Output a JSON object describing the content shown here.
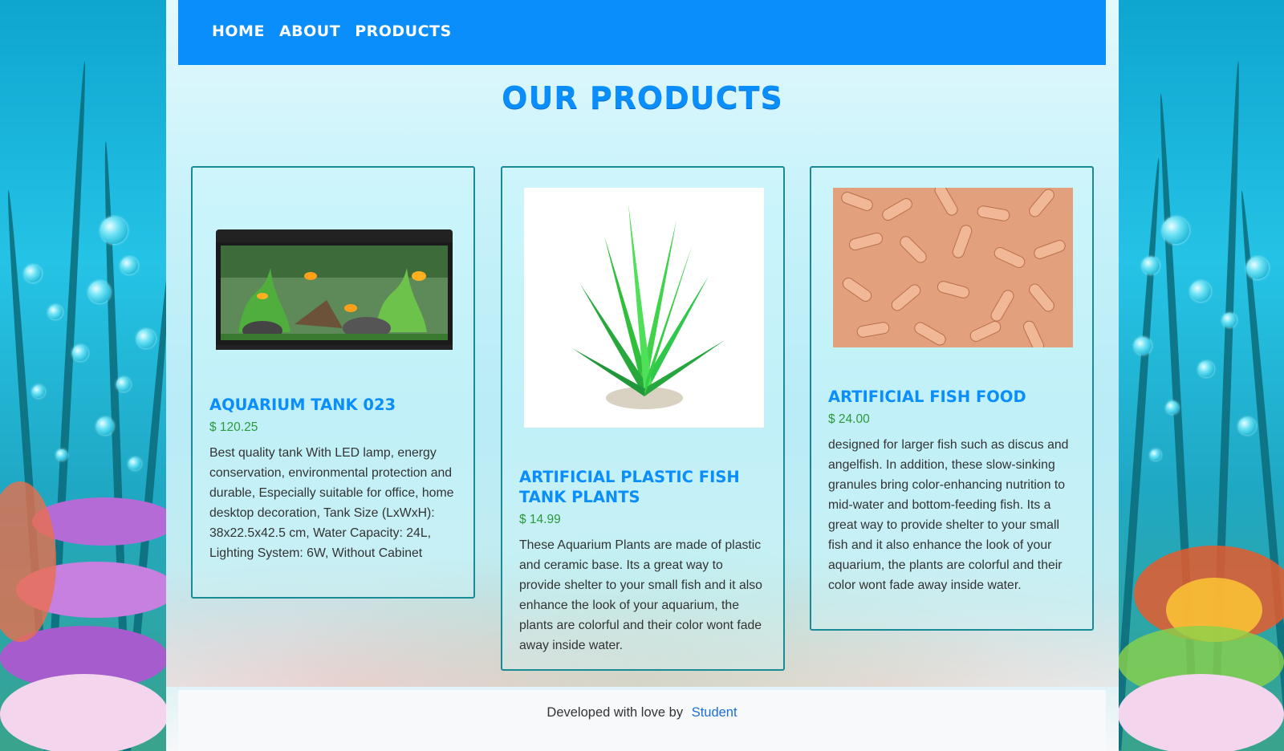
{
  "nav": {
    "links": [
      "HOME",
      "ABOUT",
      "PRODUCTS"
    ]
  },
  "page_title": "OUR PRODUCTS",
  "products": [
    {
      "name": "AQUARIUM TANK 023",
      "price": "$ 120.25",
      "description": "Best quality tank With LED lamp, energy conservation, environmental protection and durable, Especially suitable for office, home desktop decoration, Tank Size (LxWxH): 38x22.5x42.5 cm, Water Capacity: 24L, Lighting System: 6W, Without Cabinet",
      "image": "aquarium-tank-image"
    },
    {
      "name": "ARTIFICIAL PLASTIC FISH TANK PLANTS",
      "price": "$ 14.99",
      "description": "These Aquarium Plants are made of plastic and ceramic base. Its a great way to provide shelter to your small fish and it also enhance the look of your aquarium, the plants are colorful and their color wont fade away inside water.",
      "image": "plastic-plant-image"
    },
    {
      "name": "ARTIFICIAL FISH FOOD",
      "price": "$ 24.00",
      "description": "designed for larger fish such as discus and angelfish. In addition, these slow-sinking granules bring color-enhancing nutrition to mid-water and bottom-feeding fish. Its a great way to provide shelter to your small fish and it also enhance the look of your aquarium, the plants are colorful and their color wont fade away inside water.",
      "image": "fish-food-image"
    }
  ],
  "footer": {
    "text": "Developed with love by",
    "link": "Student"
  },
  "colors": {
    "nav_bg": "#0a8efc",
    "title": "#0a8efc",
    "price": "#2a9a3c",
    "card_border": "#1a8a94",
    "footer_link": "#1a6fd6"
  }
}
